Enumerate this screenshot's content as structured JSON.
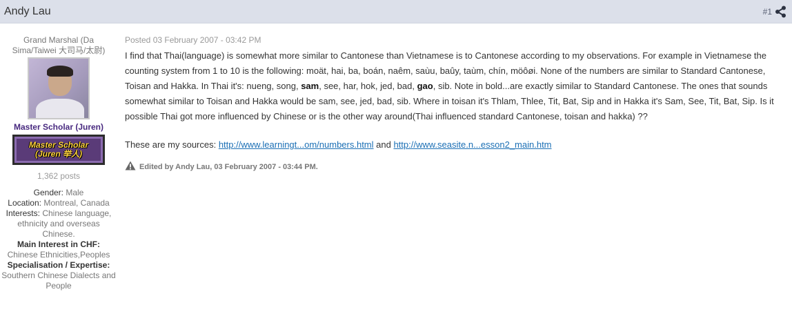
{
  "header": {
    "author": "Andy Lau",
    "post_number": "#1",
    "share_icon": "share-icon"
  },
  "sidebar": {
    "member_title": "Grand Marshal (Da Sima/Taiwei 大司马/太尉)",
    "avatar_icon": "user-avatar",
    "rank_name": "Master Scholar (Juren)",
    "rank_badge_line1": "Master Scholar",
    "rank_badge_line2": "(Juren 举人)",
    "post_count": "1,362 posts",
    "gender_label": "Gender:",
    "gender": "Male",
    "location_label": "Location:",
    "location": "Montreal, Canada",
    "interests_label": "Interests:",
    "interests": "Chinese language, ethnicity and overseas Chinese.",
    "main_interest_label": "Main Interest in CHF:",
    "main_interest": "Chinese Ethnicities,Peoples",
    "specialisation_label": "Specialisation / Expertise:",
    "specialisation": "Southern Chinese Dialects and People"
  },
  "post": {
    "date": "Posted 03 February 2007 - 03:42 PM",
    "p1": "I find that Thai(language) is somewhat more similar to Cantonese than Vietnamese is to Cantonese according to my observations. For example in Vietnamese the counting system from 1 to 10 is the following: moät, hai, ba, boán, naêm, saùu, baûy, taùm, chín, möôøi. None of the numbers are similar to Standard Cantonese, Toisan and Hakka. In Thai it's: nueng, song, ",
    "bold1": "sam",
    "p2": ", see, har, hok, jed, bad, ",
    "bold2": "gao",
    "p3": ", sib. Note in bold...are exactly similar to Standard Cantonese. The ones that sounds somewhat similar to Toisan and Hakka would be sam, see, jed, bad, sib. Where in toisan it's Thlam, Thlee, Tit, Bat, Sip and in Hakka it's Sam, See, Tit, Bat, Sip. Is it possible Thai got more influenced by Chinese or is the other way around(Thai influenced standard Cantonese, toisan and hakka) ??",
    "sources_label": "These are my sources: ",
    "link1": "http://www.learningt...om/numbers.html",
    "and": " and ",
    "link2": "http://www.seasite.n...esson2_main.htm",
    "edited": "Edited by Andy Lau, 03 February 2007 - 03:44 PM.",
    "warning_icon": "warning-icon"
  }
}
